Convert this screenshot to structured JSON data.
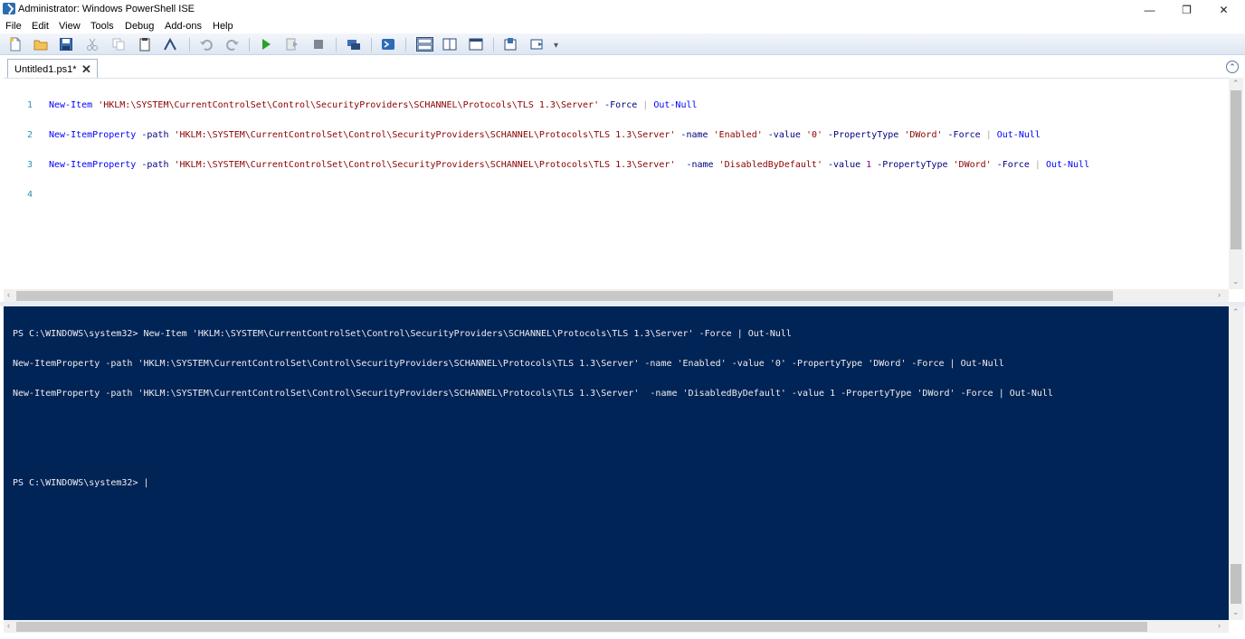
{
  "window": {
    "title": "Administrator: Windows PowerShell ISE",
    "minimize_glyph": "—",
    "restore_glyph": "❐",
    "close_glyph": "✕"
  },
  "menu": [
    "File",
    "Edit",
    "View",
    "Tools",
    "Debug",
    "Add-ons",
    "Help"
  ],
  "toolbar": {
    "icons": [
      "new-file-icon",
      "open-icon",
      "save-icon",
      "cut-icon",
      "copy-icon",
      "paste-icon",
      "clear-icon",
      "undo-icon",
      "redo-icon",
      "run-icon",
      "run-selection-icon",
      "stop-icon",
      "remote-icon",
      "powershell-icon",
      "layout-top-icon",
      "layout-right-icon",
      "layout-max-icon",
      "show-commands-icon",
      "show-addon-icon"
    ]
  },
  "tab": {
    "label": "Untitled1.ps1*",
    "close": "✕"
  },
  "collapse_glyph": "⌃",
  "editor": {
    "line_numbers": [
      "1",
      "2",
      "3",
      "4"
    ],
    "lines": [
      {
        "cmd": "New-Item",
        "path": "'HKLM:\\SYSTEM\\CurrentControlSet\\Control\\SecurityProviders\\SCHANNEL\\Protocols\\TLS 1.3\\Server'",
        "rest": "-Force",
        "pipe": "|",
        "tail": "Out-Null"
      },
      {
        "cmd": "New-ItemProperty",
        "p1": "-path",
        "path": "'HKLM:\\SYSTEM\\CurrentControlSet\\Control\\SecurityProviders\\SCHANNEL\\Protocols\\TLS 1.3\\Server'",
        "p2": "-name",
        "name": "'Enabled'",
        "p3": "-value",
        "value": "'0'",
        "p4": "-PropertyType",
        "ptype": "'DWord'",
        "p5": "-Force",
        "pipe": "|",
        "tail": "Out-Null"
      },
      {
        "cmd": "New-ItemProperty",
        "p1": "-path",
        "path": "'HKLM:\\SYSTEM\\CurrentControlSet\\Control\\SecurityProviders\\SCHANNEL\\Protocols\\TLS 1.3\\Server'",
        "p2": " -name",
        "name": "'DisabledByDefault'",
        "p3": "-value",
        "value": "1",
        "p4": "-PropertyType",
        "ptype": "'DWord'",
        "p5": "-Force",
        "pipe": "|",
        "tail": "Out-Null"
      }
    ]
  },
  "console": {
    "lines": [
      "PS C:\\WINDOWS\\system32> New-Item 'HKLM:\\SYSTEM\\CurrentControlSet\\Control\\SecurityProviders\\SCHANNEL\\Protocols\\TLS 1.3\\Server' -Force | Out-Null",
      "New-ItemProperty -path 'HKLM:\\SYSTEM\\CurrentControlSet\\Control\\SecurityProviders\\SCHANNEL\\Protocols\\TLS 1.3\\Server' -name 'Enabled' -value '0' -PropertyType 'DWord' -Force | Out-Null",
      "New-ItemProperty -path 'HKLM:\\SYSTEM\\CurrentControlSet\\Control\\SecurityProviders\\SCHANNEL\\Protocols\\TLS 1.3\\Server'  -name 'DisabledByDefault' -value 1 -PropertyType 'DWord' -Force | Out-Null",
      "",
      "",
      "PS C:\\WINDOWS\\system32> |"
    ]
  },
  "colors": {
    "console_bg": "#012456",
    "console_fg": "#eeedf0",
    "cmdlet": "#0000ff",
    "string": "#8b0000",
    "parameter": "#000080",
    "number": "#800080",
    "line_number": "#2b91af"
  }
}
